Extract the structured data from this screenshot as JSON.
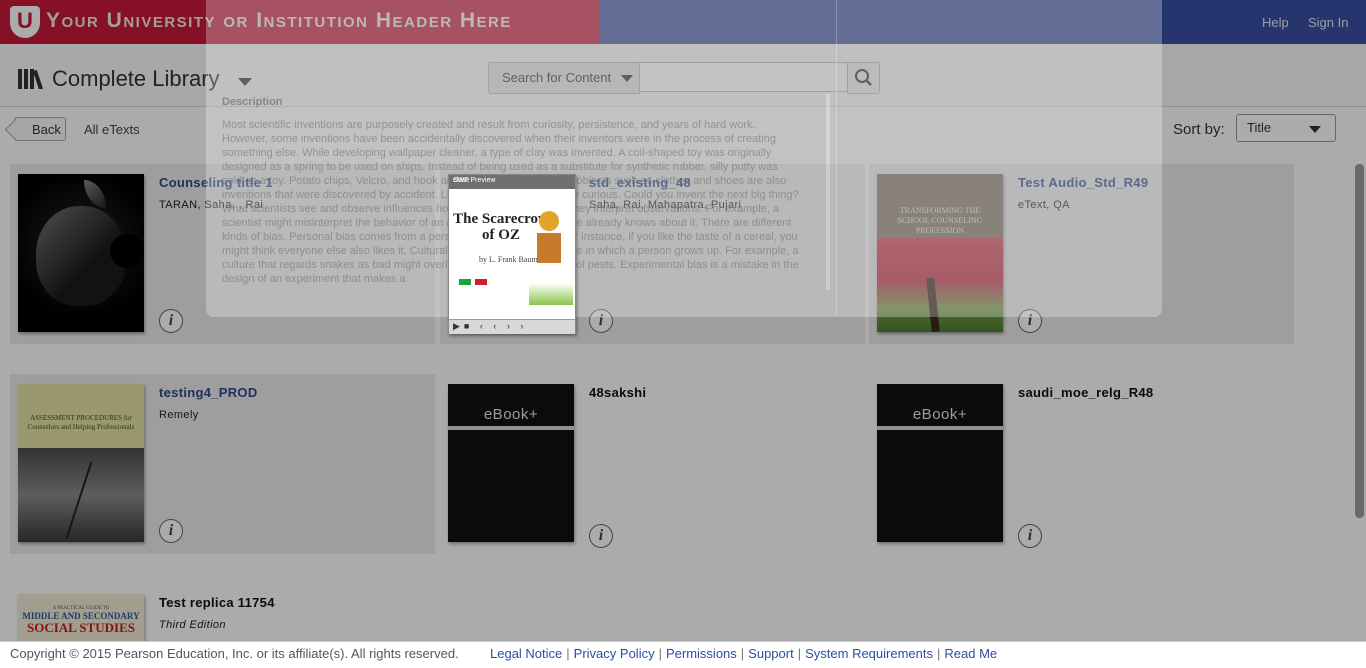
{
  "header": {
    "institution_text": "Your University or Institution Header Here",
    "logo_letter": "U",
    "help_label": "Help",
    "signin_label": "Sign In"
  },
  "library": {
    "title": "Complete Library",
    "search_scope": "Search for Content",
    "search_value": ""
  },
  "subbar": {
    "back_label": "Back",
    "all_etexts": "All eTexts",
    "sort_label": "Sort by:",
    "sort_value": "Title"
  },
  "books": [
    {
      "title": "Counseling title 1",
      "author": "TARAN, Saha, , Rai",
      "cover": "apple"
    },
    {
      "title": "std_existing_48",
      "author": "Saha, Rai, Mahapatra, Pujari",
      "cover": "swf"
    },
    {
      "title": "Test Audio_Std_R49",
      "author": "eText, QA",
      "cover": "counseling",
      "cover_text": "TRANSFORMING THE SCHOOL COUNSELING PROFESSION"
    },
    {
      "title": "testing4_PROD",
      "author": "Remely",
      "cover": "assessment",
      "cover_text": "ASSESSMENT PROCEDURES for Counselors and Helping Professionals"
    },
    {
      "title": "48sakshi",
      "author": "",
      "cover": "ebook",
      "cover_text": "eBook+"
    },
    {
      "title": "saudi_moe_relg_R48",
      "author": "",
      "cover": "ebook",
      "cover_text": "eBook+"
    },
    {
      "title": "Test replica 11754",
      "author": "Third Edition",
      "cover": "social",
      "cover_text_top": "A PRACTICAL GUIDE TO",
      "cover_text_1": "MIDDLE AND SECONDARY",
      "cover_text_2": "SOCIAL STUDIES"
    }
  ],
  "info_glyph": "i",
  "popup": {
    "description_label": "Description",
    "description_text": "Most scientific inventions are purposely created and result from curiosity, persistence, and years of hard work. However, some inventions have been accidentally discovered when their inventors were in the process of creating something else. While developing wallpaper cleaner, a type of clay was invented. A coil-shaped toy was originally designed as a spring to be used on ships. Instead of being used as a substitute for synthetic rubber, silly putty was sold as a toy. Potato chips, Velcro, and hook and loop fasteners used on objects such as clothes and shoes are also inventions that were discovered by accident. Like inventors, scientists are curious. Could you invent the next big thing? What scientists see and observe influences how they observe and how they interpret observations. For example, a scientist might misinterpret the behavior of an animal because of what she already knows about it. There are different kinds of bias. Personal bias comes from a person's likes and dislikes. For instance, if you like the taste of a cereal, you might think everyone else also likes it. Cultural bias stems from the culture in which a person grows up. For example, a culture that regards snakes as bad might overlook how well snakes control pests. Experimental bias is a mistake in the design of an experiment that makes a",
    "swf_window_title": "SWF Preview",
    "swf_close": "close",
    "swf_book_title": "The Scarecrow of OZ",
    "swf_book_author": "by L. Frank Baum"
  },
  "footer": {
    "copyright": "Copyright © 2015 Pearson Education, Inc. or its affiliate(s). All rights reserved.",
    "links": [
      "Legal Notice",
      "Privacy Policy",
      "Permissions",
      "Support",
      "System Requirements",
      "Read Me"
    ]
  },
  "colors": {
    "brand_red": "#c8193a",
    "header_blue": "#3b4fa5",
    "title_link": "#2e4a8c",
    "footer_link": "#2a4fa0"
  }
}
